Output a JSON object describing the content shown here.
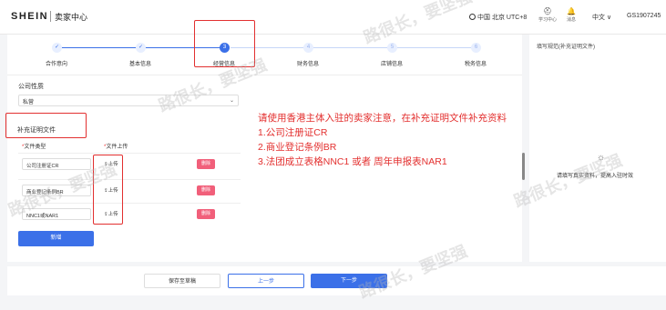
{
  "header": {
    "logo": "SHEIN",
    "subtitle": "卖家中心",
    "timezone": "中国 北京 UTC+8",
    "study_center": "学习中心",
    "messages": "消息",
    "language": "中文 ∨",
    "account": "GS1907245"
  },
  "steps": [
    {
      "label": "合作意向",
      "num": "✓",
      "state": "done"
    },
    {
      "label": "基本信息",
      "num": "✓",
      "state": "done"
    },
    {
      "label": "经营信息",
      "num": "3",
      "state": "active"
    },
    {
      "label": "财务信息",
      "num": "4",
      "state": "todo"
    },
    {
      "label": "店铺信息",
      "num": "5",
      "state": "todo"
    },
    {
      "label": "税务信息",
      "num": "6",
      "state": "todo"
    }
  ],
  "form": {
    "company_nature_label": "公司性质",
    "company_nature_value": "私营",
    "supplement_title": "补充证明文件",
    "col_type": "文件类型",
    "col_upload": "文件上传",
    "rows": [
      {
        "type": "公司注册证CR",
        "upload": "⇪上传",
        "delete": "删除"
      },
      {
        "type": "商业登记条例BR",
        "upload": "⇪上传",
        "delete": "删除"
      },
      {
        "type": "NNC1或NAR1",
        "upload": "⇪上传",
        "delete": "删除"
      }
    ],
    "add_button": "新增"
  },
  "note": {
    "line1": "请使用香港主体入驻的卖家注意，在补充证明文件补充资料",
    "line2": "1.公司注册证CR",
    "line3": "2.商业登记条例BR",
    "line4": "3.法团成立表格NNC1 或者 周年申报表NAR1"
  },
  "side": {
    "title": "填写规范(补充证明文件)",
    "hint": "请填写真实资料，提高入驻时效"
  },
  "footer": {
    "save": "保存至草稿",
    "prev": "上一步",
    "next": "下一步"
  },
  "watermark": "路很长，要坚强",
  "colors": {
    "primary": "#3b70e8",
    "danger": "#f15f7a",
    "note_red": "#e3302f"
  }
}
